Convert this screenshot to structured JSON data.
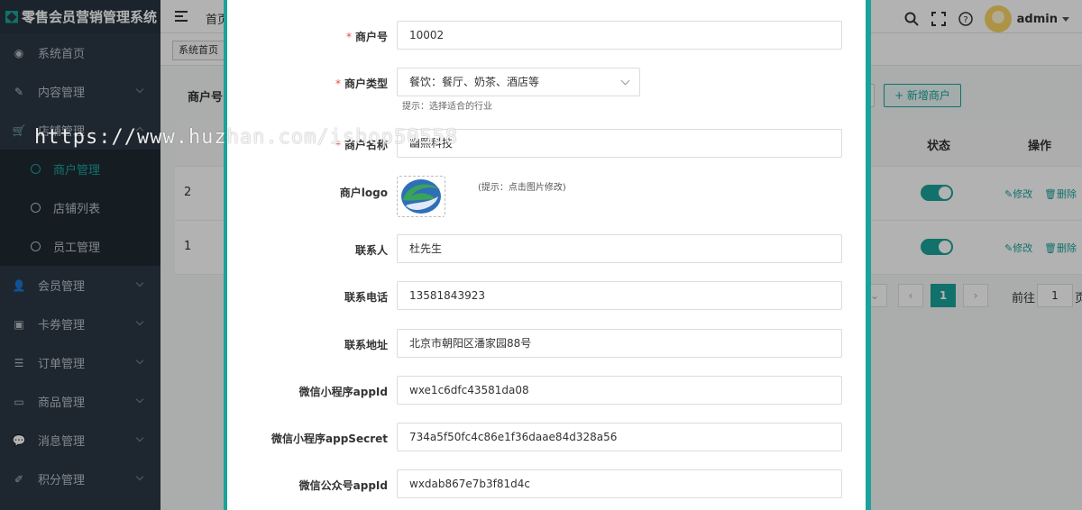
{
  "app": {
    "title": "零售会员营销管理系统"
  },
  "sidebar": {
    "items": [
      {
        "label": "系统首页",
        "icon": "dashboard-icon"
      },
      {
        "label": "内容管理",
        "icon": "edit-icon"
      },
      {
        "label": "店铺管理",
        "icon": "cart-icon"
      },
      {
        "label": "会员管理",
        "icon": "users-icon"
      },
      {
        "label": "卡券管理",
        "icon": "ticket-icon"
      },
      {
        "label": "订单管理",
        "icon": "list-icon"
      },
      {
        "label": "商品管理",
        "icon": "monitor-icon"
      },
      {
        "label": "消息管理",
        "icon": "chat-icon"
      },
      {
        "label": "积分管理",
        "icon": "points-icon"
      }
    ],
    "submenu": [
      {
        "label": "商户管理",
        "active": true
      },
      {
        "label": "店铺列表",
        "active": false
      },
      {
        "label": "员工管理",
        "active": false
      }
    ]
  },
  "topbar": {
    "crumb": "首页",
    "user": "admin"
  },
  "tabs": [
    {
      "label": "系统首页"
    }
  ],
  "background": {
    "column_label": "商户号",
    "add_button": "+ 新增商户",
    "headers": {
      "status": "状态",
      "action": "操作"
    },
    "rows": [
      {
        "id": "2",
        "edit": "修改",
        "delete": "删除"
      },
      {
        "id": "1",
        "edit": "修改",
        "delete": "删除"
      }
    ],
    "pager": {
      "current": "1",
      "goto_label": "前往",
      "goto_value": "1",
      "suffix": "页"
    }
  },
  "form": {
    "merchant_no": {
      "label": "商户号",
      "value": "10002",
      "required": true
    },
    "merchant_type": {
      "label": "商户类型",
      "value": "餐饮：餐厅、奶茶、酒店等",
      "hint": "提示：选择适合的行业",
      "required": true
    },
    "merchant_name": {
      "label": "商户名称",
      "value": "幽熙科技",
      "required": true
    },
    "merchant_logo": {
      "label": "商户logo",
      "hint": "(提示：点击图片修改)"
    },
    "contact": {
      "label": "联系人",
      "value": "杜先生"
    },
    "phone": {
      "label": "联系电话",
      "value": "13581843923"
    },
    "address": {
      "label": "联系地址",
      "value": "北京市朝阳区潘家园88号"
    },
    "mp_appid": {
      "label": "微信小程序appId",
      "value": "wxe1c6dfc43581da08"
    },
    "mp_secret": {
      "label": "微信小程序appSecret",
      "value": "734a5f50fc4c86e1f36daae84d328a56"
    },
    "oa_appid": {
      "label": "微信公众号appId",
      "value": "wxdab867e7b3f81d4c"
    }
  },
  "watermark": "https://www.huzhan.com/ishop50558",
  "colors": {
    "accent": "#1aa39a",
    "sidebar": "#2b3945",
    "required": "#e54d42"
  }
}
